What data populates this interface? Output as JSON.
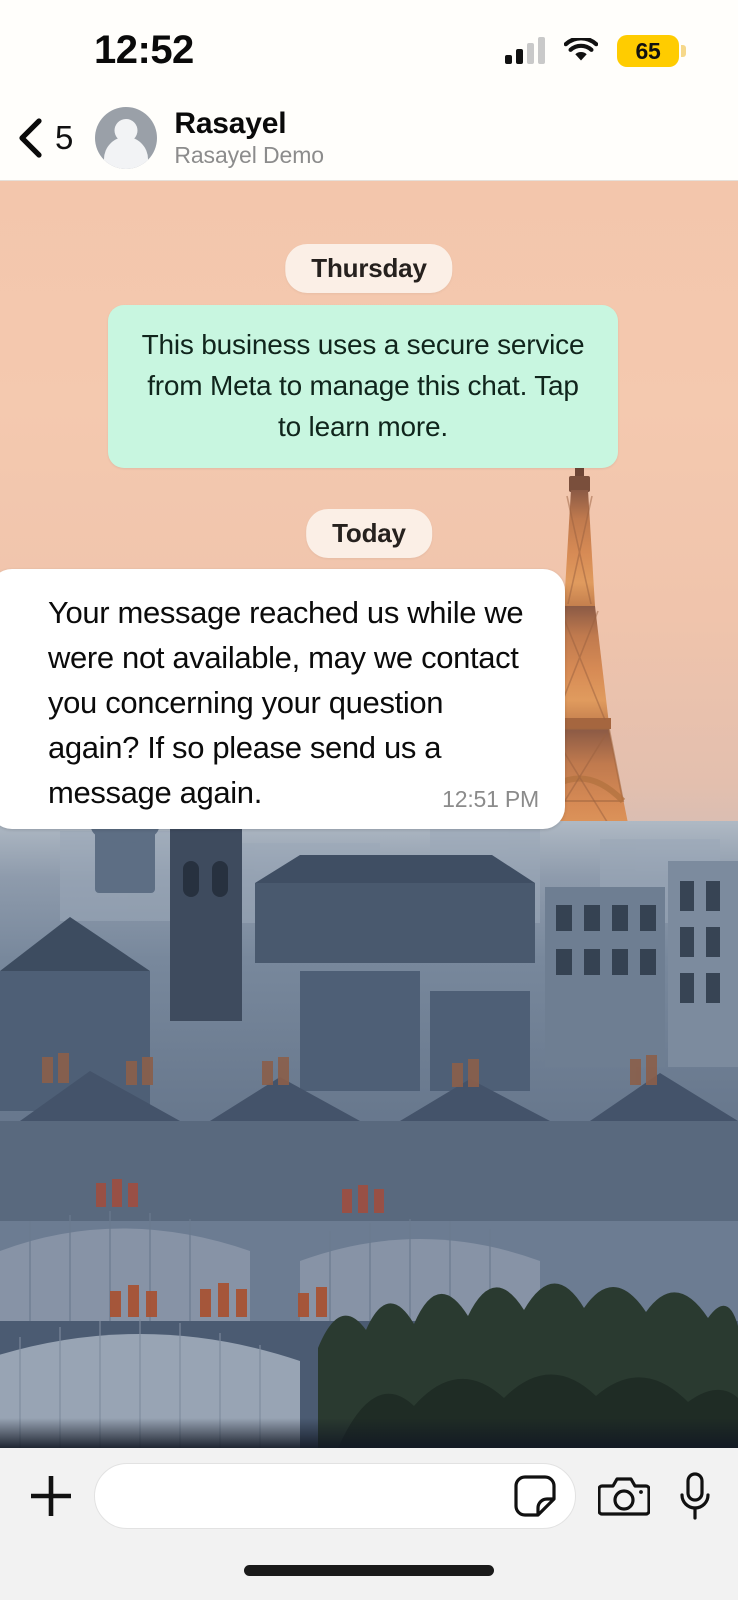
{
  "status_bar": {
    "time": "12:52",
    "battery_percent": "65",
    "signal_icon": "cellular-signal-icon",
    "wifi_icon": "wifi-icon",
    "battery_icon": "battery-low-power-icon",
    "battery_color": "#FFCC00",
    "signal_bars_filled": 2,
    "signal_bars_total": 4
  },
  "header": {
    "back_icon": "chevron-left-icon",
    "back_count": "5",
    "avatar_icon": "person-avatar-icon",
    "name": "Rasayel",
    "subtitle": "Rasayel Demo"
  },
  "chat": {
    "background_image": "paris-eiffel-tower-sunset-photo",
    "sky_color": "#F4C9AF",
    "city_color": "#6B7B90",
    "day_separators": [
      {
        "id": "thursday",
        "label": "Thursday"
      },
      {
        "id": "today",
        "label": "Today"
      }
    ],
    "encryption_notice": {
      "text": "This business uses a secure service from Meta to manage this chat. Tap to learn more.",
      "bubble_color": "#C8F6E0"
    },
    "messages": [
      {
        "id": "incoming-1",
        "direction": "incoming",
        "text": "Your message reached us while we were not available, may we contact you concerning your question again? If so please send us a message again.",
        "time": "12:51 PM",
        "bubble_color": "#FFFFFF"
      }
    ]
  },
  "input_bar": {
    "attach_icon": "plus-icon",
    "message_placeholder": "",
    "message_value": "",
    "sticker_icon": "sticker-icon",
    "camera_icon": "camera-icon",
    "mic_icon": "microphone-icon",
    "background_color": "#F2F2F2"
  },
  "home_indicator": "home-indicator"
}
